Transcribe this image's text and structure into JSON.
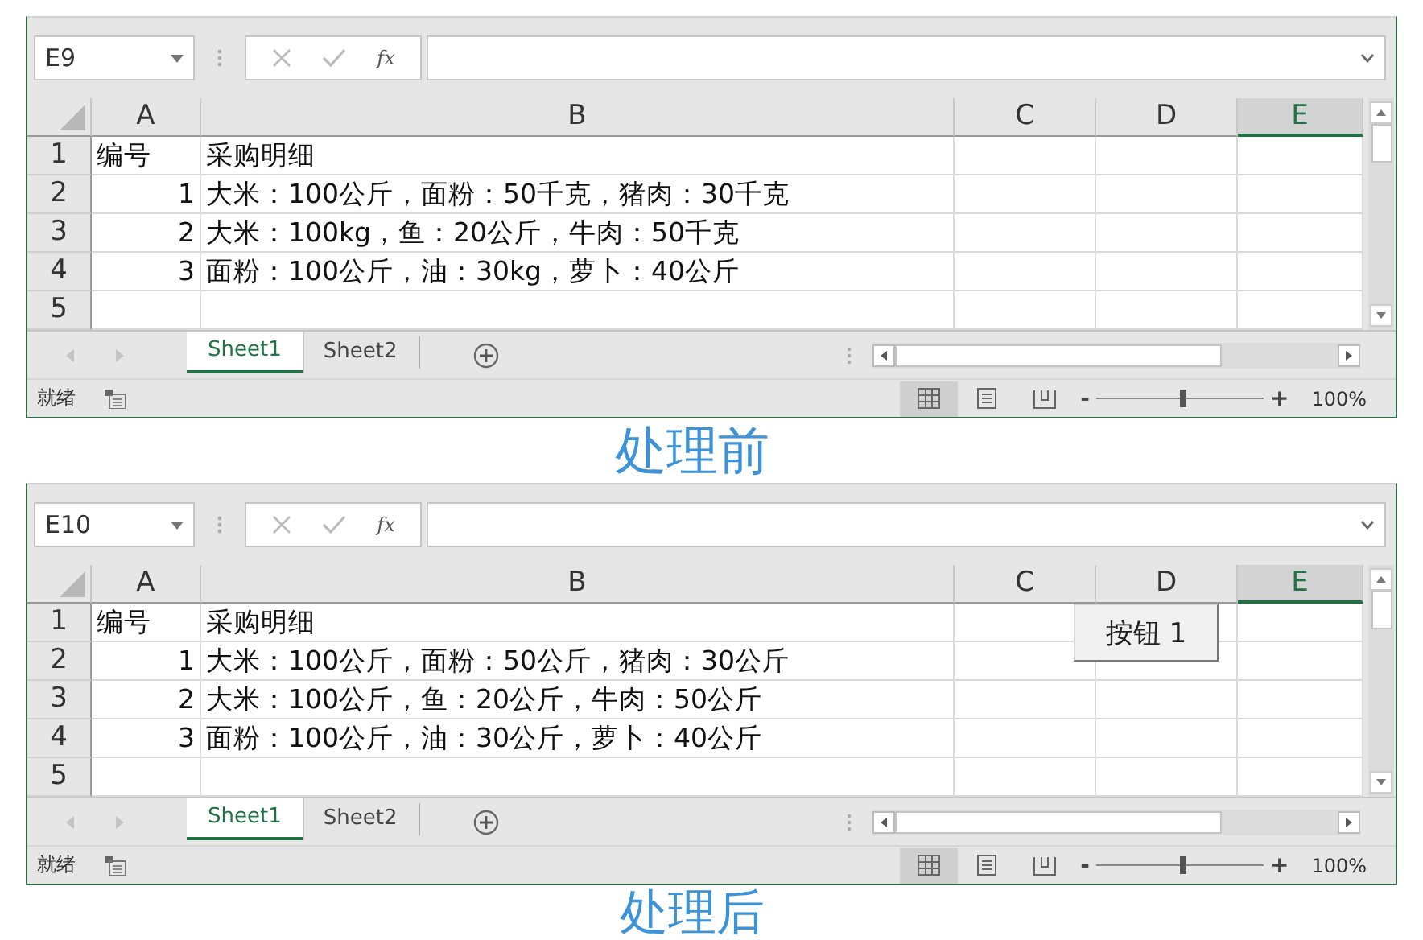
{
  "panels": [
    {
      "name_box": "E9",
      "insert_function": "fx",
      "columns": [
        {
          "label": "A",
          "selected": false
        },
        {
          "label": "B",
          "selected": false
        },
        {
          "label": "C",
          "selected": false
        },
        {
          "label": "D",
          "selected": false
        },
        {
          "label": "E",
          "selected": true
        }
      ],
      "rows": [
        {
          "header": "1",
          "cells": [
            {
              "text": "编号",
              "kind": "text"
            },
            {
              "text": "采购明细",
              "kind": "text"
            }
          ]
        },
        {
          "header": "2",
          "cells": [
            {
              "text": "1",
              "kind": "number"
            },
            {
              "text": "大米：100公斤，面粉：50千克，猪肉：30千克",
              "kind": "text"
            }
          ]
        },
        {
          "header": "3",
          "cells": [
            {
              "text": "2",
              "kind": "number"
            },
            {
              "text": "大米：100kg，鱼：20公斤，牛肉：50千克",
              "kind": "text"
            }
          ]
        },
        {
          "header": "4",
          "cells": [
            {
              "text": "3",
              "kind": "number"
            },
            {
              "text": "面粉：100公斤，油：30kg，萝卜：40公斤",
              "kind": "text"
            }
          ]
        },
        {
          "header": "5"
        }
      ],
      "sheet_tabs": [
        {
          "label": "Sheet1",
          "selected": true
        },
        {
          "label": "Sheet2",
          "selected": false
        }
      ],
      "status": "就绪",
      "views": [
        {
          "kind": "normal",
          "selected": true
        },
        {
          "kind": "page_layout",
          "selected": false
        },
        {
          "kind": "page_break",
          "selected": false
        }
      ],
      "zoom": {
        "minus": "-",
        "plus": "+",
        "level": 0.5,
        "reading": "100%"
      },
      "caption": "处理前"
    },
    {
      "name_box": "E10",
      "insert_function": "fx",
      "columns": [
        {
          "label": "A",
          "selected": false
        },
        {
          "label": "B",
          "selected": false
        },
        {
          "label": "C",
          "selected": false
        },
        {
          "label": "D",
          "selected": false
        },
        {
          "label": "E",
          "selected": true
        }
      ],
      "rows": [
        {
          "header": "1",
          "cells": [
            {
              "text": "编号",
              "kind": "text"
            },
            {
              "text": "采购明细",
              "kind": "text"
            }
          ]
        },
        {
          "header": "2",
          "cells": [
            {
              "text": "1",
              "kind": "number"
            },
            {
              "text": "大米：100公斤，面粉：50公斤，猪肉：30公斤",
              "kind": "text"
            }
          ]
        },
        {
          "header": "3",
          "cells": [
            {
              "text": "2",
              "kind": "number"
            },
            {
              "text": "大米：100公斤，鱼：20公斤，牛肉：50公斤",
              "kind": "text"
            }
          ]
        },
        {
          "header": "4",
          "cells": [
            {
              "text": "3",
              "kind": "number"
            },
            {
              "text": "面粉：100公斤，油：30公斤，萝卜：40公斤",
              "kind": "text"
            }
          ]
        },
        {
          "header": "5"
        }
      ],
      "form_button": "按钮 1",
      "sheet_tabs": [
        {
          "label": "Sheet1",
          "selected": true
        },
        {
          "label": "Sheet2",
          "selected": false
        }
      ],
      "status": "就绪",
      "views": [
        {
          "kind": "normal",
          "selected": true
        },
        {
          "kind": "page_layout",
          "selected": false
        },
        {
          "kind": "page_break",
          "selected": false
        }
      ],
      "zoom": {
        "minus": "-",
        "plus": "+",
        "level": 0.5,
        "reading": "100%"
      },
      "caption": "处理后"
    }
  ]
}
